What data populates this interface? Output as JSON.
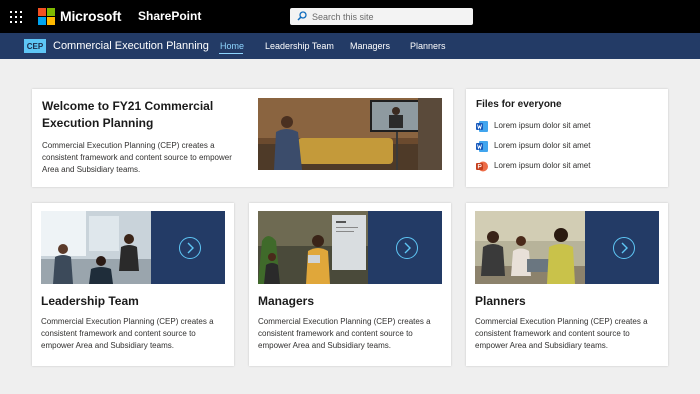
{
  "suite": {
    "brand": "Microsoft",
    "app": "SharePoint",
    "search_placeholder": "Search this site",
    "icons": [
      "waffle-icon",
      "microsoft-logo",
      "search-icon"
    ]
  },
  "site": {
    "badge": "CEP",
    "title": "Commercial Execution Planning",
    "nav": [
      {
        "label": "Home",
        "active": true
      },
      {
        "label": "Leadership Team",
        "active": false
      },
      {
        "label": "Managers",
        "active": false
      },
      {
        "label": "Planners",
        "active": false
      }
    ]
  },
  "welcome": {
    "title": "Welcome to FY21 Commercial Execution Planning",
    "body": "Commercial Execution Planning (CEP) creates a consistent framework and content source to empower Area and Subsidiary teams."
  },
  "files": {
    "title": "Files for everyone",
    "items": [
      {
        "name": "Lorem ipsum dolor sit amet",
        "type": "word-icon"
      },
      {
        "name": "Lorem ipsum dolor sit amet",
        "type": "word-icon"
      },
      {
        "name": "Lorem ipsum dolor sit amet",
        "type": "powerpoint-icon"
      }
    ]
  },
  "tiles": [
    {
      "title": "Leadership Team",
      "body": "Commercial Execution Planning (CEP) creates a consistent framework and content source to empower Area and Subsidiary teams."
    },
    {
      "title": "Managers",
      "body": "Commercial Execution Planning (CEP) creates a consistent framework and content source to empower Area and Subsidiary teams."
    },
    {
      "title": "Planners",
      "body": "Commercial Execution Planning (CEP) creates a consistent framework and content source to empower Area and Subsidiary teams."
    }
  ],
  "colors": {
    "suite_bar": "#000000",
    "site_bar": "#233b66",
    "accent": "#5ec6f5",
    "page_bg": "#efefef"
  }
}
